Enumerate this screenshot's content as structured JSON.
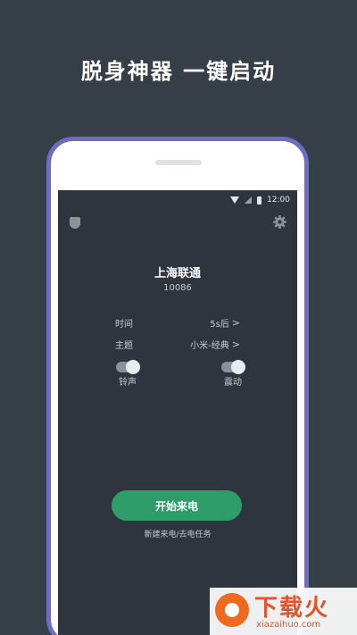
{
  "headline": "脱身神器 一键启动",
  "status_bar": {
    "time": "12:00"
  },
  "call": {
    "carrier": "上海联通",
    "number": "10086"
  },
  "settings": [
    {
      "label": "时间",
      "value": "5s后",
      "chevron": ">"
    },
    {
      "label": "主题",
      "value": "小米-经典",
      "chevron": ">"
    }
  ],
  "toggles": [
    {
      "label": "铃声",
      "on": true
    },
    {
      "label": "震动",
      "on": true
    }
  ],
  "start_button": {
    "label": "开始来电"
  },
  "new_task_link": "新建来电/去电任务",
  "icons": {
    "shield": "shield-icon",
    "settings": "gear-icon"
  },
  "colors": {
    "accent": "#2e9d69",
    "phone_frame": "#6e6cc4",
    "background": "#363e48"
  },
  "watermark": {
    "title": "下载火",
    "url": "xiazaihuo.com"
  }
}
